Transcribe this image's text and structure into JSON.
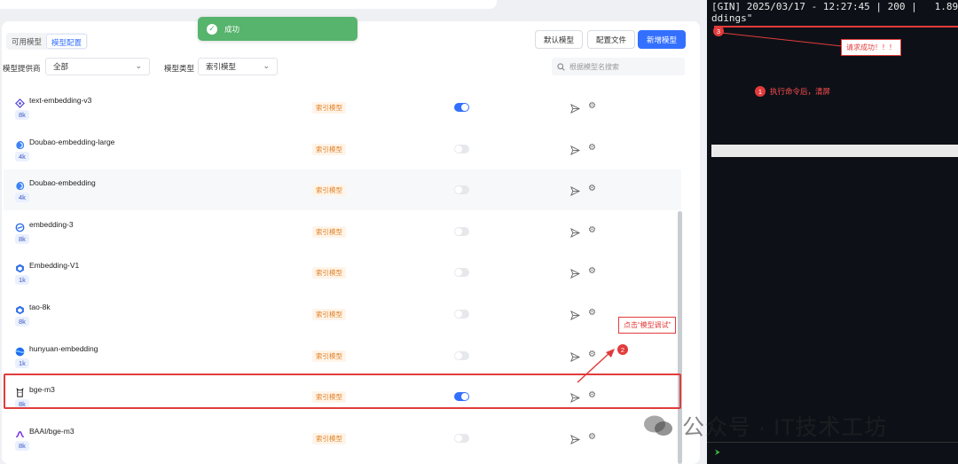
{
  "tabs": [
    "可用模型",
    "模型配置"
  ],
  "active_tab": 1,
  "buttons": {
    "default_model": "默认模型",
    "config_file": "配置文件",
    "add_model": "新增模型"
  },
  "filters": {
    "provider_label": "模型提供商",
    "provider_value": "全部",
    "type_label": "模型类型",
    "type_value": "索引模型",
    "search_placeholder": "根据模型名搜索"
  },
  "toast": "成功",
  "models": [
    {
      "name": "text-embedding-v3",
      "context": "8k",
      "type": "索引模型",
      "enabled": true,
      "icon": "qwen-icon"
    },
    {
      "name": "Doubao-embedding-large",
      "context": "4k",
      "type": "索引模型",
      "enabled": false,
      "icon": "doubao-icon"
    },
    {
      "name": "Doubao-embedding",
      "context": "4k",
      "type": "索引模型",
      "enabled": false,
      "icon": "doubao-icon"
    },
    {
      "name": "embedding-3",
      "context": "8k",
      "type": "索引模型",
      "enabled": false,
      "icon": "zhipu-icon"
    },
    {
      "name": "Embedding-V1",
      "context": "1k",
      "type": "索引模型",
      "enabled": false,
      "icon": "ernie-icon"
    },
    {
      "name": "tao-8k",
      "context": "8k",
      "type": "索引模型",
      "enabled": false,
      "icon": "ernie-icon"
    },
    {
      "name": "hunyuan-embedding",
      "context": "1k",
      "type": "索引模型",
      "enabled": false,
      "icon": "hunyuan-icon"
    },
    {
      "name": "bge-m3",
      "context": "8k",
      "type": "索引模型",
      "enabled": true,
      "icon": "ollama-icon"
    },
    {
      "name": "BAAI/bge-m3",
      "context": "8k",
      "type": "索引模型",
      "enabled": false,
      "icon": "siliconflow-icon"
    }
  ],
  "annotations": {
    "debug_callout": "点击“模型调试”",
    "debug_badge": "2",
    "clear_badge": "1",
    "clear_note": "执行命令后，清屏",
    "success_badge": "3",
    "success_callout": "请求成功！！！"
  },
  "terminal": {
    "line1": "[GIN] 2025/03/17 - 12:27:45 | 200 |   1.89",
    "line2": "ddings\""
  },
  "watermark": "公众号 · IT技术工坊",
  "colors": {
    "primary": "#3370ff",
    "success": "#56b46d",
    "annotation": "#e23b3b",
    "type_tag": "#e0832a"
  }
}
